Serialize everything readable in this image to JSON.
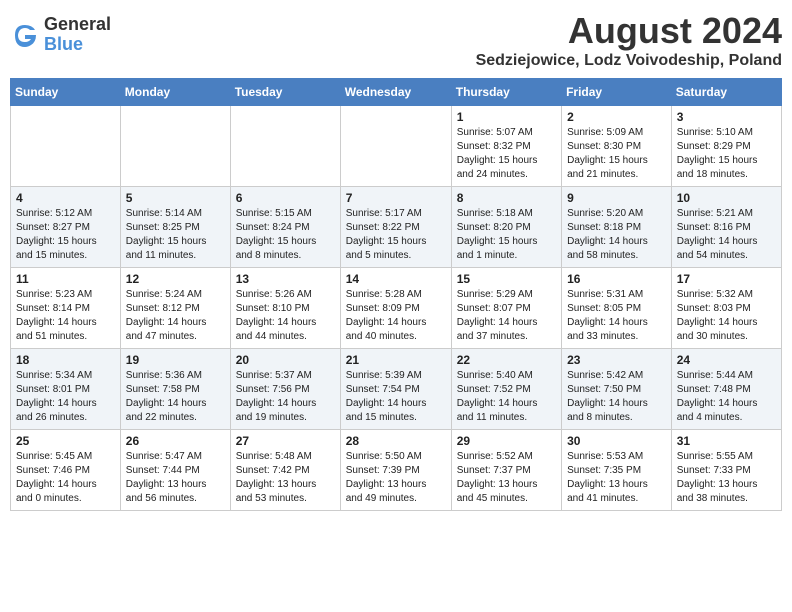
{
  "logo": {
    "general": "General",
    "blue": "Blue"
  },
  "header": {
    "month_year": "August 2024",
    "location": "Sedziejowice, Lodz Voivodeship, Poland"
  },
  "weekdays": [
    "Sunday",
    "Monday",
    "Tuesday",
    "Wednesday",
    "Thursday",
    "Friday",
    "Saturday"
  ],
  "weeks": [
    [
      {
        "day": "",
        "info": ""
      },
      {
        "day": "",
        "info": ""
      },
      {
        "day": "",
        "info": ""
      },
      {
        "day": "",
        "info": ""
      },
      {
        "day": "1",
        "info": "Sunrise: 5:07 AM\nSunset: 8:32 PM\nDaylight: 15 hours\nand 24 minutes."
      },
      {
        "day": "2",
        "info": "Sunrise: 5:09 AM\nSunset: 8:30 PM\nDaylight: 15 hours\nand 21 minutes."
      },
      {
        "day": "3",
        "info": "Sunrise: 5:10 AM\nSunset: 8:29 PM\nDaylight: 15 hours\nand 18 minutes."
      }
    ],
    [
      {
        "day": "4",
        "info": "Sunrise: 5:12 AM\nSunset: 8:27 PM\nDaylight: 15 hours\nand 15 minutes."
      },
      {
        "day": "5",
        "info": "Sunrise: 5:14 AM\nSunset: 8:25 PM\nDaylight: 15 hours\nand 11 minutes."
      },
      {
        "day": "6",
        "info": "Sunrise: 5:15 AM\nSunset: 8:24 PM\nDaylight: 15 hours\nand 8 minutes."
      },
      {
        "day": "7",
        "info": "Sunrise: 5:17 AM\nSunset: 8:22 PM\nDaylight: 15 hours\nand 5 minutes."
      },
      {
        "day": "8",
        "info": "Sunrise: 5:18 AM\nSunset: 8:20 PM\nDaylight: 15 hours\nand 1 minute."
      },
      {
        "day": "9",
        "info": "Sunrise: 5:20 AM\nSunset: 8:18 PM\nDaylight: 14 hours\nand 58 minutes."
      },
      {
        "day": "10",
        "info": "Sunrise: 5:21 AM\nSunset: 8:16 PM\nDaylight: 14 hours\nand 54 minutes."
      }
    ],
    [
      {
        "day": "11",
        "info": "Sunrise: 5:23 AM\nSunset: 8:14 PM\nDaylight: 14 hours\nand 51 minutes."
      },
      {
        "day": "12",
        "info": "Sunrise: 5:24 AM\nSunset: 8:12 PM\nDaylight: 14 hours\nand 47 minutes."
      },
      {
        "day": "13",
        "info": "Sunrise: 5:26 AM\nSunset: 8:10 PM\nDaylight: 14 hours\nand 44 minutes."
      },
      {
        "day": "14",
        "info": "Sunrise: 5:28 AM\nSunset: 8:09 PM\nDaylight: 14 hours\nand 40 minutes."
      },
      {
        "day": "15",
        "info": "Sunrise: 5:29 AM\nSunset: 8:07 PM\nDaylight: 14 hours\nand 37 minutes."
      },
      {
        "day": "16",
        "info": "Sunrise: 5:31 AM\nSunset: 8:05 PM\nDaylight: 14 hours\nand 33 minutes."
      },
      {
        "day": "17",
        "info": "Sunrise: 5:32 AM\nSunset: 8:03 PM\nDaylight: 14 hours\nand 30 minutes."
      }
    ],
    [
      {
        "day": "18",
        "info": "Sunrise: 5:34 AM\nSunset: 8:01 PM\nDaylight: 14 hours\nand 26 minutes."
      },
      {
        "day": "19",
        "info": "Sunrise: 5:36 AM\nSunset: 7:58 PM\nDaylight: 14 hours\nand 22 minutes."
      },
      {
        "day": "20",
        "info": "Sunrise: 5:37 AM\nSunset: 7:56 PM\nDaylight: 14 hours\nand 19 minutes."
      },
      {
        "day": "21",
        "info": "Sunrise: 5:39 AM\nSunset: 7:54 PM\nDaylight: 14 hours\nand 15 minutes."
      },
      {
        "day": "22",
        "info": "Sunrise: 5:40 AM\nSunset: 7:52 PM\nDaylight: 14 hours\nand 11 minutes."
      },
      {
        "day": "23",
        "info": "Sunrise: 5:42 AM\nSunset: 7:50 PM\nDaylight: 14 hours\nand 8 minutes."
      },
      {
        "day": "24",
        "info": "Sunrise: 5:44 AM\nSunset: 7:48 PM\nDaylight: 14 hours\nand 4 minutes."
      }
    ],
    [
      {
        "day": "25",
        "info": "Sunrise: 5:45 AM\nSunset: 7:46 PM\nDaylight: 14 hours\nand 0 minutes."
      },
      {
        "day": "26",
        "info": "Sunrise: 5:47 AM\nSunset: 7:44 PM\nDaylight: 13 hours\nand 56 minutes."
      },
      {
        "day": "27",
        "info": "Sunrise: 5:48 AM\nSunset: 7:42 PM\nDaylight: 13 hours\nand 53 minutes."
      },
      {
        "day": "28",
        "info": "Sunrise: 5:50 AM\nSunset: 7:39 PM\nDaylight: 13 hours\nand 49 minutes."
      },
      {
        "day": "29",
        "info": "Sunrise: 5:52 AM\nSunset: 7:37 PM\nDaylight: 13 hours\nand 45 minutes."
      },
      {
        "day": "30",
        "info": "Sunrise: 5:53 AM\nSunset: 7:35 PM\nDaylight: 13 hours\nand 41 minutes."
      },
      {
        "day": "31",
        "info": "Sunrise: 5:55 AM\nSunset: 7:33 PM\nDaylight: 13 hours\nand 38 minutes."
      }
    ]
  ]
}
